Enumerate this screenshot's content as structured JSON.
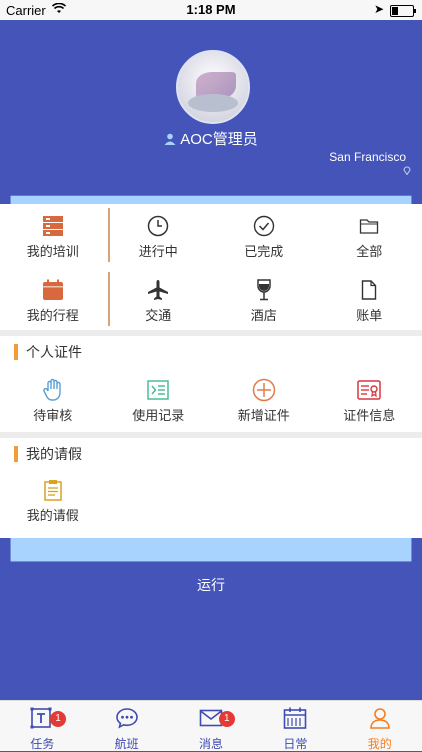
{
  "status_bar": {
    "carrier": "Carrier",
    "time": "1:18 PM"
  },
  "profile": {
    "name": "AOC管理员",
    "department": "运行",
    "location": "San Francisco"
  },
  "quick_grid": {
    "row1": [
      {
        "label": "我的培训",
        "icon": "training-icon"
      },
      {
        "label": "进行中",
        "icon": "clock-icon"
      },
      {
        "label": "已完成",
        "icon": "check-circle-icon"
      },
      {
        "label": "全部",
        "icon": "folder-icon"
      }
    ],
    "row2": [
      {
        "label": "我的行程",
        "icon": "calendar-icon"
      },
      {
        "label": "交通",
        "icon": "airplane-icon"
      },
      {
        "label": "酒店",
        "icon": "wine-icon"
      },
      {
        "label": "账单",
        "icon": "document-icon"
      }
    ]
  },
  "certificates": {
    "title": "个人证件",
    "items": [
      {
        "label": "待审核",
        "icon": "hand-icon"
      },
      {
        "label": "使用记录",
        "icon": "records-icon"
      },
      {
        "label": "新增证件",
        "icon": "add-circle-icon"
      },
      {
        "label": "证件信息",
        "icon": "id-card-icon"
      }
    ]
  },
  "leave": {
    "title": "我的请假",
    "items": [
      {
        "label": "我的请假",
        "icon": "clipboard-icon"
      }
    ]
  },
  "bottom_nav": {
    "items": [
      {
        "label": "任务",
        "icon": "task-icon",
        "badge": "1"
      },
      {
        "label": "航班",
        "icon": "chat-icon",
        "badge": ""
      },
      {
        "label": "消息",
        "icon": "mail-icon",
        "badge": "1"
      },
      {
        "label": "日常",
        "icon": "calendar-grid-icon",
        "badge": ""
      },
      {
        "label": "我的",
        "icon": "person-icon",
        "badge": ""
      }
    ],
    "active_index": 4
  },
  "colors": {
    "brand": "#4454b8",
    "accent": "#f47e20",
    "badge": "#e53935"
  }
}
